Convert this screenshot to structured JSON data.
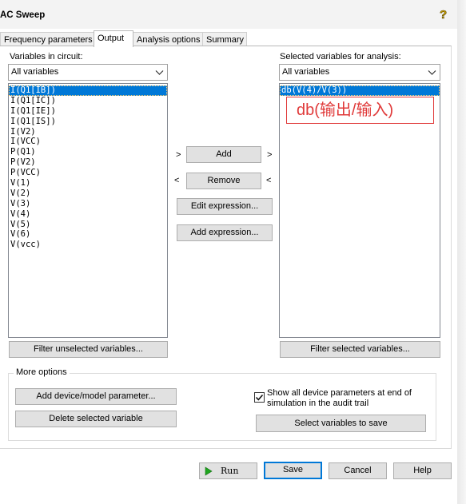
{
  "window": {
    "title": "AC Sweep"
  },
  "tabs": [
    {
      "label": "Frequency parameters"
    },
    {
      "label": "Output"
    },
    {
      "label": "Analysis options"
    },
    {
      "label": "Summary"
    }
  ],
  "output": {
    "variables_in_circuit_label": "Variables in circuit:",
    "variables_filter_value": "All variables",
    "circuit_variables": [
      "I(Q1[IB])",
      "I(Q1[IC])",
      "I(Q1[IE])",
      "I(Q1[IS])",
      "I(V2)",
      "I(VCC)",
      "P(Q1)",
      "P(V2)",
      "P(VCC)",
      "V(1)",
      "V(2)",
      "V(3)",
      "V(4)",
      "V(5)",
      "V(6)",
      "V(vcc)"
    ],
    "selected_label": "Selected variables for analysis:",
    "selected_filter_value": "All variables",
    "selected_variables": [
      "db(V(4)/V(3))"
    ],
    "annotation_text": "db(输出/输入)",
    "add_label": "Add",
    "remove_label": "Remove",
    "edit_expression_label": "Edit expression...",
    "add_expression_label": "Add expression...",
    "arrow_right": ">",
    "arrow_left": "<",
    "filter_unselected_label": "Filter unselected variables...",
    "filter_selected_label": "Filter selected variables..."
  },
  "more_options": {
    "legend": "More options",
    "add_device_param_label": "Add device/model parameter...",
    "delete_selected_label": "Delete selected variable",
    "show_all_params_label": "Show all device parameters at end of simulation in the audit trail",
    "show_all_params_checked": true,
    "select_vars_to_save_label": "Select variables to save"
  },
  "footer": {
    "run_label": "Run",
    "save_label": "Save",
    "cancel_label": "Cancel",
    "help_label": "Help"
  },
  "colors": {
    "selection": "#0078d7",
    "annotation": "#e03a3a",
    "run_icon": "#1fa61f",
    "help_icon": "#c8a000"
  },
  "icons": {
    "help": "question-mark-icon",
    "run": "play-icon",
    "dropdown": "chevron-down-icon",
    "checkbox": "check-icon"
  }
}
